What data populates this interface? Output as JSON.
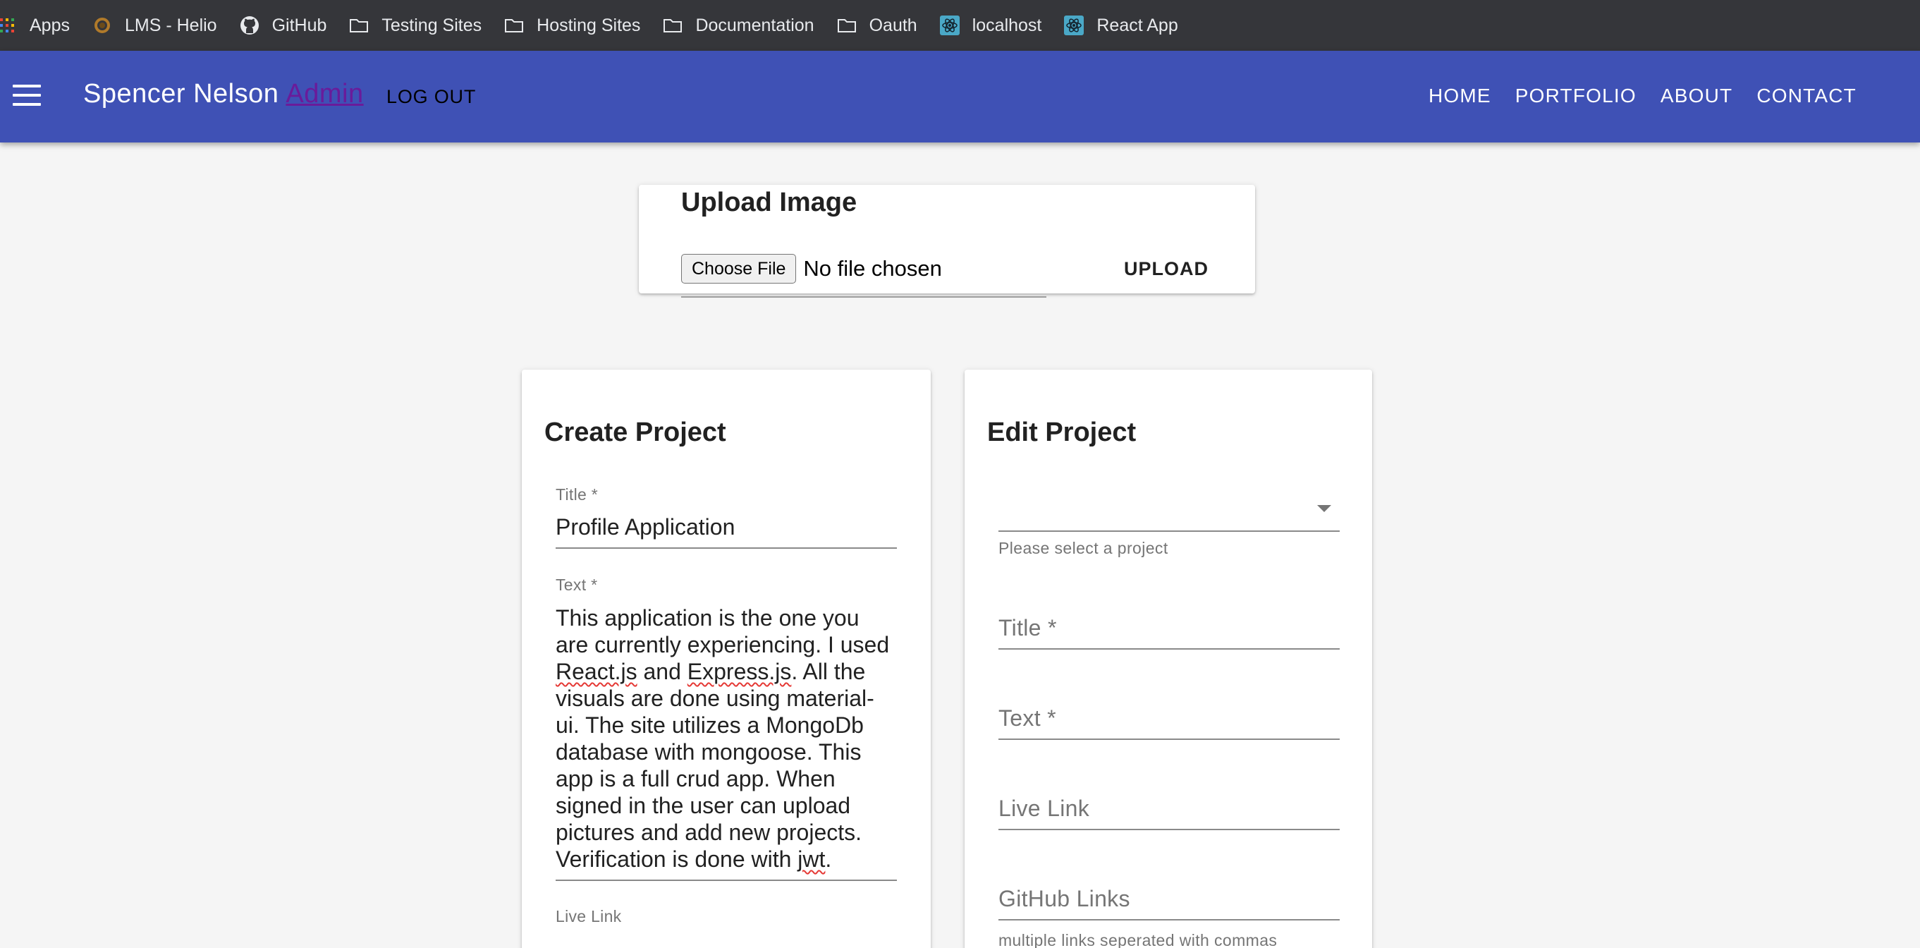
{
  "bookmarks": [
    {
      "label": "Apps",
      "icon": "apps-grid-icon"
    },
    {
      "label": "LMS - Helio",
      "icon": "helio-icon"
    },
    {
      "label": "GitHub",
      "icon": "github-icon"
    },
    {
      "label": "Testing Sites",
      "icon": "folder-icon"
    },
    {
      "label": "Hosting Sites",
      "icon": "folder-icon"
    },
    {
      "label": "Documentation",
      "icon": "folder-icon"
    },
    {
      "label": "Oauth",
      "icon": "folder-icon"
    },
    {
      "label": "localhost",
      "icon": "react-icon"
    },
    {
      "label": "React App",
      "icon": "react-icon"
    }
  ],
  "header": {
    "brand_name": "Spencer Nelson",
    "admin_label": "Admin",
    "logout_label": "LOG OUT",
    "nav": [
      "HOME",
      "PORTFOLIO",
      "ABOUT",
      "CONTACT"
    ]
  },
  "upload": {
    "title": "Upload Image",
    "choose_file_label": "Choose File",
    "file_status": "No file chosen",
    "upload_label": "UPLOAD"
  },
  "create": {
    "title": "Create Project",
    "title_label": "Title *",
    "title_value": "Profile Application",
    "text_label": "Text *",
    "text_parts": [
      "This application is the one you are currently experiencing. I used ",
      "React.js",
      " and ",
      "Express.js",
      ". All the visuals are done using material-ui. The site utilizes a MongoDb database with mongoose. This app is a full crud app. When signed in the user can upload pictures and add new projects. Verification is done with ",
      "jwt",
      "."
    ],
    "live_link_label": "Live Link"
  },
  "edit": {
    "title": "Edit Project",
    "select_helper": "Please select a project",
    "title_label": "Title *",
    "text_label": "Text *",
    "live_link_label": "Live Link",
    "github_label": "GitHub Links",
    "github_helper": "multiple links seperated with commas"
  },
  "colors": {
    "appbar": "#3f51b5",
    "admin_link": "#6a1b9a",
    "bookmarks_bg": "#35363a"
  }
}
